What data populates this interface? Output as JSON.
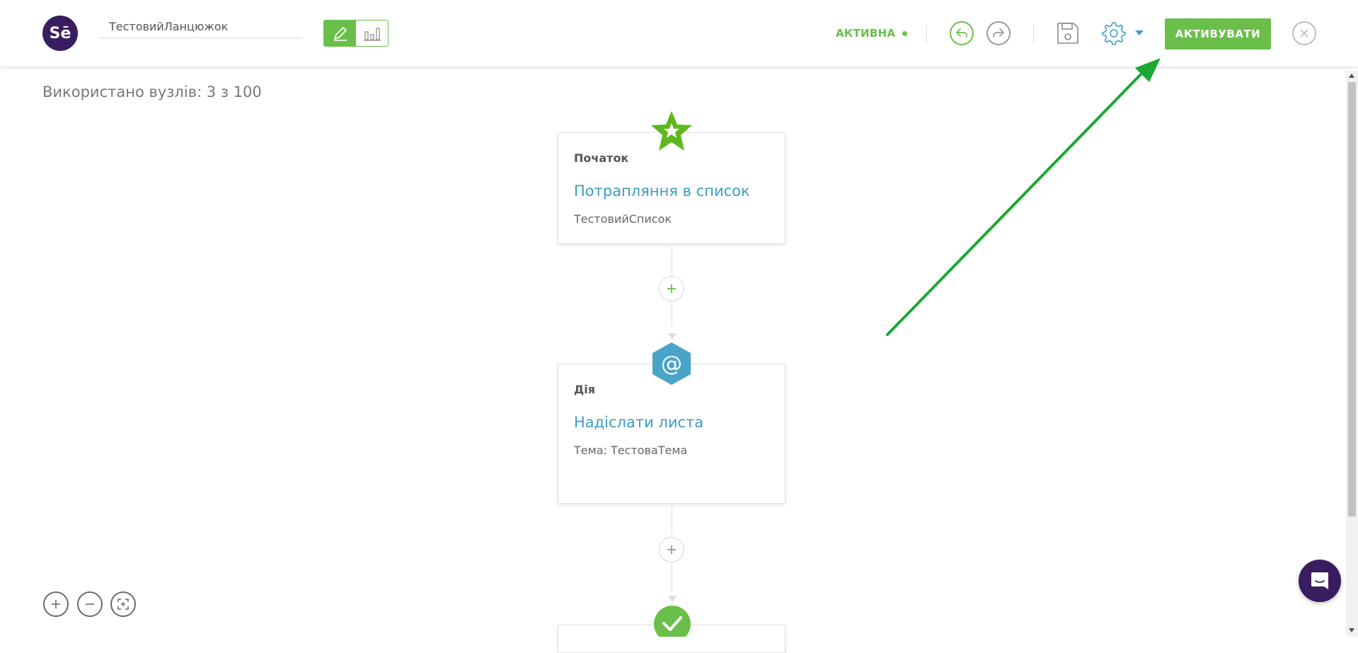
{
  "header": {
    "logo_text": "Sē",
    "chain_name": "ТестовийЛанцюжок",
    "status": "АКТИВНА",
    "activate_label": "АКТИВУВАТИ"
  },
  "canvas": {
    "nodes_used": "Використано вузлів: 3 з 100"
  },
  "nodes": [
    {
      "type": "Початок",
      "title": "Потрапляння в список",
      "subtitle": "ТестовийСписок",
      "icon": "star-icon"
    },
    {
      "type": "Дія",
      "title": "Надіслати листа",
      "subtitle": "Тема: ТестоваТема",
      "icon": "at-sign-icon"
    },
    {
      "icon": "check-icon"
    }
  ],
  "colors": {
    "accent_green": "#6abf4b",
    "brand_purple": "#3a1d5f",
    "link_blue": "#3c9dc4",
    "action_hex": "#4aa3c8",
    "annotation_arrow": "#1aa832"
  },
  "icons": [
    "pencil-icon",
    "bar-chart-icon",
    "undo-icon",
    "redo-icon",
    "save-icon",
    "gear-icon",
    "caret-down-icon",
    "close-icon",
    "plus-icon",
    "minus-icon",
    "fit-screen-icon",
    "chat-icon"
  ]
}
